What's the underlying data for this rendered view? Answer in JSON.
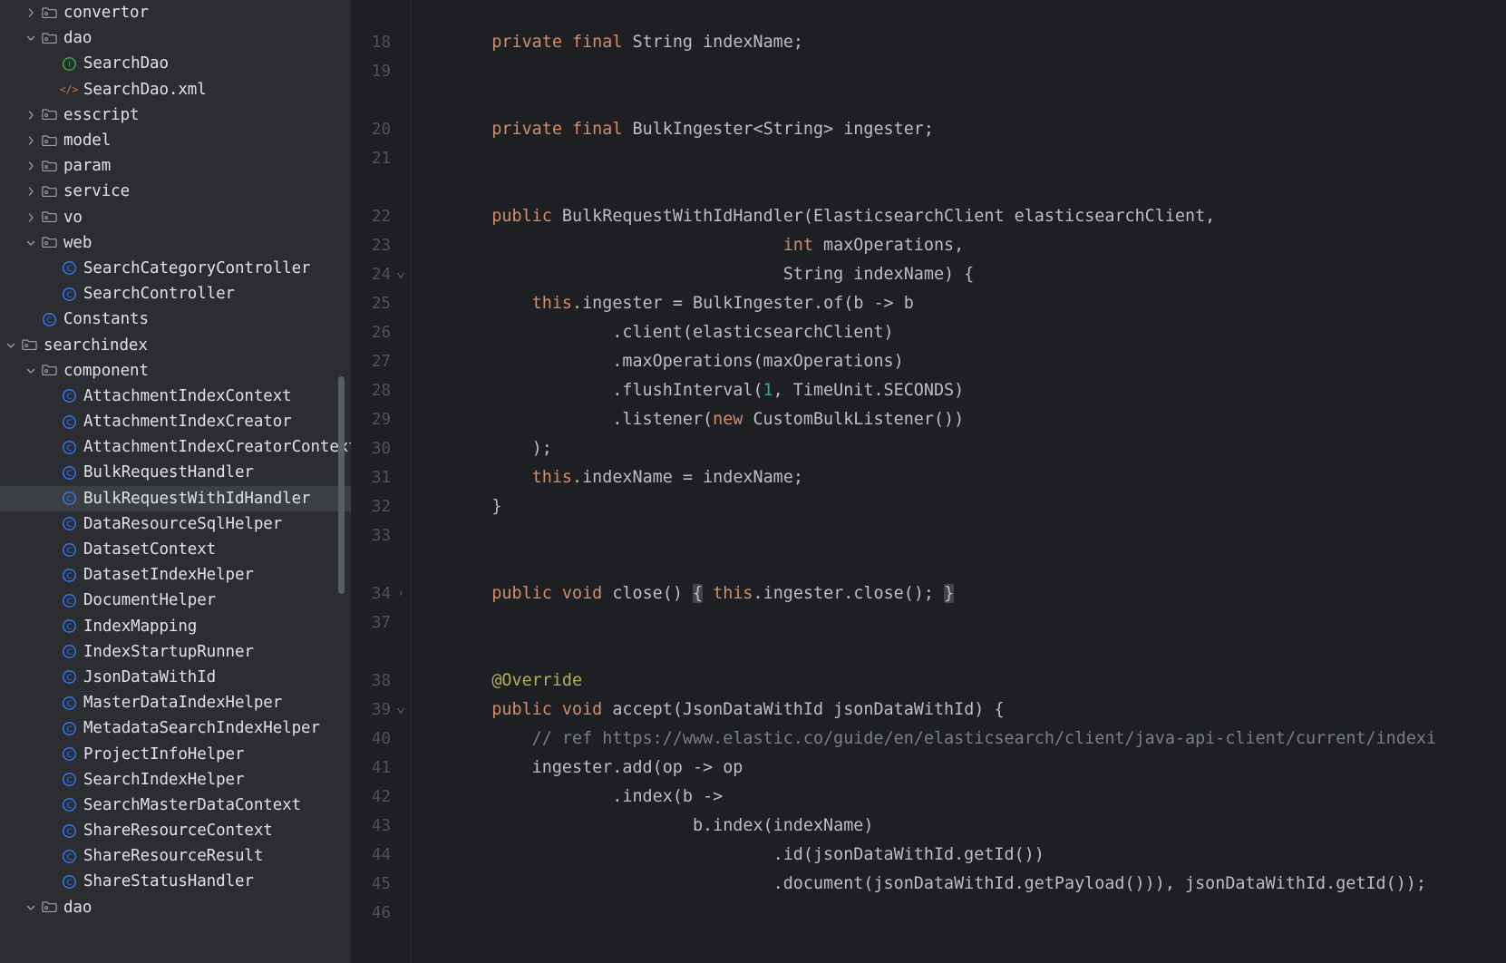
{
  "theme": {
    "sidebar_bg": "#2b2d30",
    "editor_bg": "#1e1f22",
    "selection_bg": "#3c3f41",
    "text": "#dfe1e5",
    "keyword": "#cf8e6d",
    "number": "#2aacb8",
    "comment": "#7a7e85",
    "annotation": "#b3ae60",
    "line_number": "#4e5157",
    "class_icon": "#3574f0",
    "interface_icon": "#42a047",
    "xml_icon": "#c77b5c"
  },
  "sidebar": {
    "name": "project-tree",
    "items": [
      {
        "label": "convertor",
        "kind": "folder",
        "indent": 1,
        "arrow": "right",
        "selected": false
      },
      {
        "label": "dao",
        "kind": "folder",
        "indent": 1,
        "arrow": "down",
        "selected": false
      },
      {
        "label": "SearchDao",
        "kind": "interface",
        "indent": 2,
        "arrow": "none",
        "selected": false
      },
      {
        "label": "SearchDao.xml",
        "kind": "xml",
        "indent": 2,
        "arrow": "none",
        "selected": false
      },
      {
        "label": "esscript",
        "kind": "folder",
        "indent": 1,
        "arrow": "right",
        "selected": false
      },
      {
        "label": "model",
        "kind": "folder",
        "indent": 1,
        "arrow": "right",
        "selected": false
      },
      {
        "label": "param",
        "kind": "folder",
        "indent": 1,
        "arrow": "right",
        "selected": false
      },
      {
        "label": "service",
        "kind": "folder",
        "indent": 1,
        "arrow": "right",
        "selected": false
      },
      {
        "label": "vo",
        "kind": "folder",
        "indent": 1,
        "arrow": "right",
        "selected": false
      },
      {
        "label": "web",
        "kind": "folder",
        "indent": 1,
        "arrow": "down",
        "selected": false
      },
      {
        "label": "SearchCategoryController",
        "kind": "class",
        "indent": 2,
        "arrow": "none",
        "selected": false
      },
      {
        "label": "SearchController",
        "kind": "class",
        "indent": 2,
        "arrow": "none",
        "selected": false
      },
      {
        "label": "Constants",
        "kind": "class",
        "indent": 1,
        "arrow": "none",
        "selected": false
      },
      {
        "label": "searchindex",
        "kind": "folder",
        "indent": 0,
        "arrow": "down",
        "selected": false
      },
      {
        "label": "component",
        "kind": "folder",
        "indent": 1,
        "arrow": "down",
        "selected": false
      },
      {
        "label": "AttachmentIndexContext",
        "kind": "class",
        "indent": 2,
        "arrow": "none",
        "selected": false
      },
      {
        "label": "AttachmentIndexCreator",
        "kind": "class",
        "indent": 2,
        "arrow": "none",
        "selected": false
      },
      {
        "label": "AttachmentIndexCreatorContext",
        "kind": "class",
        "indent": 2,
        "arrow": "none",
        "selected": false
      },
      {
        "label": "BulkRequestHandler",
        "kind": "class",
        "indent": 2,
        "arrow": "none",
        "selected": false
      },
      {
        "label": "BulkRequestWithIdHandler",
        "kind": "class",
        "indent": 2,
        "arrow": "none",
        "selected": true
      },
      {
        "label": "DataResourceSqlHelper",
        "kind": "class",
        "indent": 2,
        "arrow": "none",
        "selected": false
      },
      {
        "label": "DatasetContext",
        "kind": "class",
        "indent": 2,
        "arrow": "none",
        "selected": false
      },
      {
        "label": "DatasetIndexHelper",
        "kind": "class",
        "indent": 2,
        "arrow": "none",
        "selected": false
      },
      {
        "label": "DocumentHelper",
        "kind": "class",
        "indent": 2,
        "arrow": "none",
        "selected": false
      },
      {
        "label": "IndexMapping",
        "kind": "class",
        "indent": 2,
        "arrow": "none",
        "selected": false
      },
      {
        "label": "IndexStartupRunner",
        "kind": "class",
        "indent": 2,
        "arrow": "none",
        "selected": false
      },
      {
        "label": "JsonDataWithId",
        "kind": "class",
        "indent": 2,
        "arrow": "none",
        "selected": false
      },
      {
        "label": "MasterDataIndexHelper",
        "kind": "class",
        "indent": 2,
        "arrow": "none",
        "selected": false
      },
      {
        "label": "MetadataSearchIndexHelper",
        "kind": "class",
        "indent": 2,
        "arrow": "none",
        "selected": false
      },
      {
        "label": "ProjectInfoHelper",
        "kind": "class",
        "indent": 2,
        "arrow": "none",
        "selected": false
      },
      {
        "label": "SearchIndexHelper",
        "kind": "class",
        "indent": 2,
        "arrow": "none",
        "selected": false
      },
      {
        "label": "SearchMasterDataContext",
        "kind": "class",
        "indent": 2,
        "arrow": "none",
        "selected": false
      },
      {
        "label": "ShareResourceContext",
        "kind": "class",
        "indent": 2,
        "arrow": "none",
        "selected": false
      },
      {
        "label": "ShareResourceResult",
        "kind": "class",
        "indent": 2,
        "arrow": "none",
        "selected": false
      },
      {
        "label": "ShareStatusHandler",
        "kind": "class",
        "indent": 2,
        "arrow": "none",
        "selected": false
      },
      {
        "label": "dao",
        "kind": "folder",
        "indent": 1,
        "arrow": "down",
        "selected": false
      }
    ]
  },
  "editor": {
    "name": "code-editor",
    "language": "java",
    "lines": [
      {
        "num": "18",
        "fold": "none",
        "indent": 0,
        "tokens": [
          {
            "t": "    ",
            "c": "pln"
          },
          {
            "t": "private final",
            "c": "kw"
          },
          {
            "t": " String indexName;",
            "c": "pln"
          }
        ]
      },
      {
        "num": "19",
        "fold": "none",
        "indent": 0,
        "tokens": []
      },
      {
        "num": "",
        "fold": "none",
        "indent": 0,
        "tokens": []
      },
      {
        "num": "20",
        "fold": "none",
        "indent": 0,
        "tokens": [
          {
            "t": "    ",
            "c": "pln"
          },
          {
            "t": "private final",
            "c": "kw"
          },
          {
            "t": " BulkIngester<String> ingester;",
            "c": "pln"
          }
        ]
      },
      {
        "num": "21",
        "fold": "none",
        "indent": 0,
        "tokens": []
      },
      {
        "num": "",
        "fold": "none",
        "indent": 0,
        "tokens": []
      },
      {
        "num": "22",
        "fold": "none",
        "indent": 0,
        "tokens": [
          {
            "t": "    ",
            "c": "pln"
          },
          {
            "t": "public",
            "c": "kw"
          },
          {
            "t": " BulkRequestWithIdHandler(ElasticsearchClient elasticsearchClient,",
            "c": "pln"
          }
        ]
      },
      {
        "num": "23",
        "fold": "none",
        "indent": 0,
        "tokens": [
          {
            "t": "                                 ",
            "c": "pln"
          },
          {
            "t": "int",
            "c": "kw"
          },
          {
            "t": " maxOperations,",
            "c": "pln"
          }
        ]
      },
      {
        "num": "24",
        "fold": "down",
        "indent": 0,
        "tokens": [
          {
            "t": "                                 String indexName) {",
            "c": "pln"
          }
        ]
      },
      {
        "num": "25",
        "fold": "none",
        "indent": 0,
        "tokens": [
          {
            "t": "        ",
            "c": "pln"
          },
          {
            "t": "this",
            "c": "kw"
          },
          {
            "t": ".ingester = BulkIngester.of(b -> b",
            "c": "pln"
          }
        ]
      },
      {
        "num": "26",
        "fold": "none",
        "indent": 0,
        "tokens": [
          {
            "t": "                .client(elasticsearchClient)",
            "c": "pln"
          }
        ]
      },
      {
        "num": "27",
        "fold": "none",
        "indent": 0,
        "tokens": [
          {
            "t": "                .maxOperations(maxOperations)",
            "c": "pln"
          }
        ]
      },
      {
        "num": "28",
        "fold": "none",
        "indent": 0,
        "tokens": [
          {
            "t": "                .flushInterval(",
            "c": "pln"
          },
          {
            "t": "1",
            "c": "num"
          },
          {
            "t": ", TimeUnit.SECONDS)",
            "c": "pln"
          }
        ]
      },
      {
        "num": "29",
        "fold": "none",
        "indent": 0,
        "tokens": [
          {
            "t": "                .listener(",
            "c": "pln"
          },
          {
            "t": "new",
            "c": "kw"
          },
          {
            "t": " CustomBulkListener())",
            "c": "pln"
          }
        ]
      },
      {
        "num": "30",
        "fold": "none",
        "indent": 0,
        "tokens": [
          {
            "t": "        );",
            "c": "pln"
          }
        ]
      },
      {
        "num": "31",
        "fold": "none",
        "indent": 0,
        "tokens": [
          {
            "t": "        ",
            "c": "pln"
          },
          {
            "t": "this",
            "c": "kw"
          },
          {
            "t": ".indexName = indexName;",
            "c": "pln"
          }
        ]
      },
      {
        "num": "32",
        "fold": "none",
        "indent": 0,
        "tokens": [
          {
            "t": "    }",
            "c": "pln"
          }
        ]
      },
      {
        "num": "33",
        "fold": "none",
        "indent": 0,
        "tokens": []
      },
      {
        "num": "",
        "fold": "none",
        "indent": 0,
        "tokens": []
      },
      {
        "num": "34",
        "fold": "right",
        "indent": 0,
        "tokens": [
          {
            "t": "    ",
            "c": "pln"
          },
          {
            "t": "public void",
            "c": "kw"
          },
          {
            "t": " close() ",
            "c": "pln"
          },
          {
            "t": "{",
            "c": "foldbrace"
          },
          {
            "t": " ",
            "c": "pln"
          },
          {
            "t": "this",
            "c": "kw"
          },
          {
            "t": ".ingester.close(); ",
            "c": "pln"
          },
          {
            "t": "}",
            "c": "foldbrace"
          }
        ]
      },
      {
        "num": "37",
        "fold": "none",
        "indent": 0,
        "tokens": []
      },
      {
        "num": "",
        "fold": "none",
        "indent": 0,
        "tokens": []
      },
      {
        "num": "38",
        "fold": "none",
        "indent": 0,
        "tokens": [
          {
            "t": "    ",
            "c": "pln"
          },
          {
            "t": "@Override",
            "c": "anno"
          }
        ]
      },
      {
        "num": "39",
        "fold": "down",
        "indent": 0,
        "tokens": [
          {
            "t": "    ",
            "c": "pln"
          },
          {
            "t": "public void",
            "c": "kw"
          },
          {
            "t": " accept(JsonDataWithId jsonDataWithId) {",
            "c": "pln"
          }
        ]
      },
      {
        "num": "40",
        "fold": "none",
        "indent": 0,
        "tokens": [
          {
            "t": "        ",
            "c": "pln"
          },
          {
            "t": "// ref https://www.elastic.co/guide/en/elasticsearch/client/java-api-client/current/indexi",
            "c": "cmt"
          }
        ]
      },
      {
        "num": "41",
        "fold": "none",
        "indent": 0,
        "tokens": [
          {
            "t": "        ingester.add(op -> op",
            "c": "pln"
          }
        ]
      },
      {
        "num": "42",
        "fold": "none",
        "indent": 0,
        "tokens": [
          {
            "t": "                .index(b ->",
            "c": "pln"
          }
        ]
      },
      {
        "num": "43",
        "fold": "none",
        "indent": 0,
        "tokens": [
          {
            "t": "                        b.index(indexName)",
            "c": "pln"
          }
        ]
      },
      {
        "num": "44",
        "fold": "none",
        "indent": 0,
        "tokens": [
          {
            "t": "                                .id(jsonDataWithId.getId())",
            "c": "pln"
          }
        ]
      },
      {
        "num": "45",
        "fold": "none",
        "indent": 0,
        "tokens": [
          {
            "t": "                                .document(jsonDataWithId.getPayload())), jsonDataWithId.getId());",
            "c": "pln"
          }
        ]
      },
      {
        "num": "46",
        "fold": "none",
        "indent": 0,
        "tokens": []
      }
    ]
  }
}
